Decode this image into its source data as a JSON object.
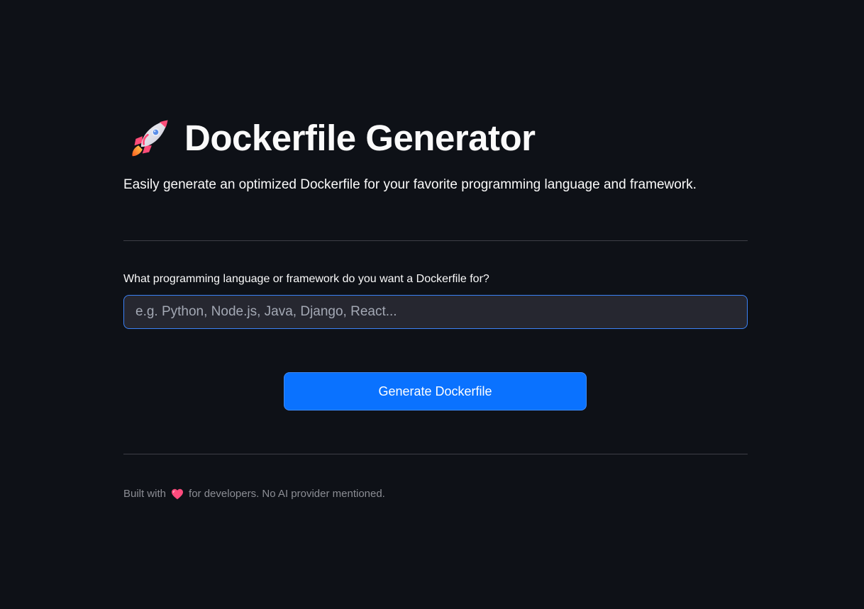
{
  "header": {
    "title": "Dockerfile Generator",
    "icon": "rocket-icon",
    "subtitle": "Easily generate an optimized Dockerfile for your favorite programming language and framework."
  },
  "form": {
    "label": "What programming language or framework do you want a Dockerfile for?",
    "input_value": "",
    "placeholder": "e.g. Python, Node.js, Java, Django, React...",
    "button_label": "Generate Dockerfile"
  },
  "footer": {
    "prefix": "Built with",
    "icon": "heart-icon",
    "suffix": "for developers. No AI provider mentioned."
  },
  "colors": {
    "background": "#0e1117",
    "accent": "#0a72ff",
    "input_border": "#3b82f6",
    "heart": "#ff4b7d"
  }
}
